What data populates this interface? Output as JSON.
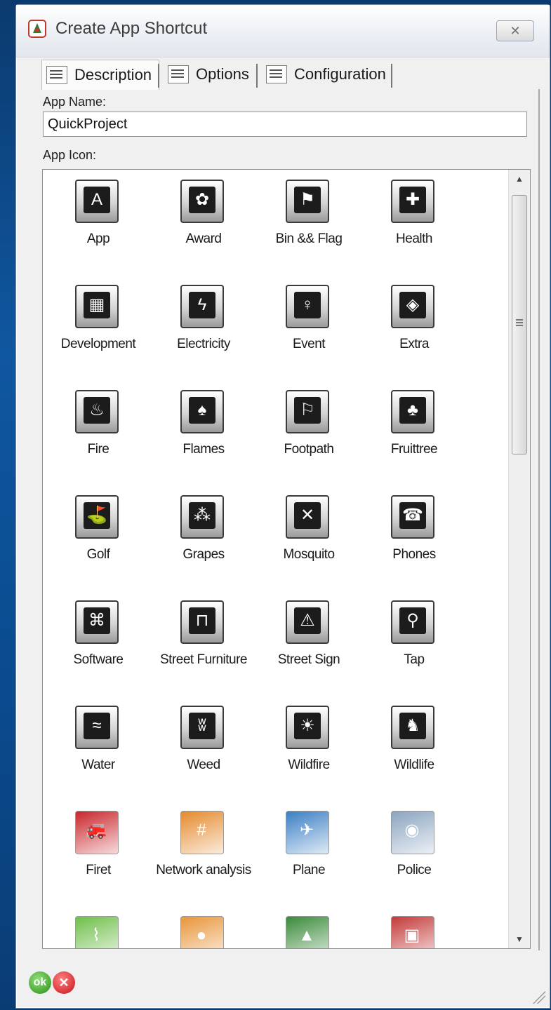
{
  "window": {
    "title": "Create App Shortcut",
    "close_glyph": "✕",
    "accent_color": "#0f57a0"
  },
  "tabs": [
    {
      "label": "Description",
      "icon": "description-tab-icon",
      "active": true
    },
    {
      "label": "Options",
      "icon": "options-tab-icon",
      "active": false
    },
    {
      "label": "Configuration",
      "icon": "configuration-tab-icon",
      "active": false
    }
  ],
  "form": {
    "app_name_label": "App Name:",
    "app_name_value": "QuickProject",
    "app_icon_label": "App Icon:"
  },
  "icons": [
    {
      "label": "App",
      "icon": "app-icon",
      "glyph": "A"
    },
    {
      "label": "Award",
      "icon": "award-icon",
      "glyph": "✿"
    },
    {
      "label": "Bin && Flag",
      "icon": "bin-flag-icon",
      "glyph": "⚑"
    },
    {
      "label": "Health",
      "icon": "health-icon",
      "glyph": "✚"
    },
    {
      "label": "Development",
      "icon": "development-icon",
      "glyph": "▦"
    },
    {
      "label": "Electricity",
      "icon": "electricity-icon",
      "glyph": "ϟ"
    },
    {
      "label": "Event",
      "icon": "event-icon",
      "glyph": "♀"
    },
    {
      "label": "Extra",
      "icon": "extra-icon",
      "glyph": "◈"
    },
    {
      "label": "Fire",
      "icon": "fire-icon",
      "glyph": "♨"
    },
    {
      "label": "Flames",
      "icon": "flames-icon",
      "glyph": "♠"
    },
    {
      "label": "Footpath",
      "icon": "footpath-icon",
      "glyph": "⚐"
    },
    {
      "label": "Fruittree",
      "icon": "fruittree-icon",
      "glyph": "♣"
    },
    {
      "label": "Golf",
      "icon": "golf-icon",
      "glyph": "⛳"
    },
    {
      "label": "Grapes",
      "icon": "grapes-icon",
      "glyph": "⁂"
    },
    {
      "label": "Mosquito",
      "icon": "mosquito-icon",
      "glyph": "✕"
    },
    {
      "label": "Phones",
      "icon": "phones-icon",
      "glyph": "☎"
    },
    {
      "label": "Software",
      "icon": "software-icon",
      "glyph": "⌘"
    },
    {
      "label": "Street Furniture",
      "icon": "street-furniture-icon",
      "glyph": "⊓"
    },
    {
      "label": "Street Sign",
      "icon": "street-sign-icon",
      "glyph": "⚠"
    },
    {
      "label": "Tap",
      "icon": "tap-icon",
      "glyph": "⚲"
    },
    {
      "label": "Water",
      "icon": "water-icon",
      "glyph": "≈"
    },
    {
      "label": "Weed",
      "icon": "weed-icon",
      "glyph": "ʬ"
    },
    {
      "label": "Wildfire",
      "icon": "wildfire-icon",
      "glyph": "☀"
    },
    {
      "label": "Wildlife",
      "icon": "wildlife-icon",
      "glyph": "♞"
    },
    {
      "label": "Firet",
      "icon": "fire-truck-icon",
      "glyph": "🚒",
      "color": "#c8262c"
    },
    {
      "label": "Network analysis",
      "icon": "network-analysis-icon",
      "glyph": "#",
      "color": "#e58a2e"
    },
    {
      "label": "Plane",
      "icon": "plane-icon",
      "glyph": "✈",
      "color": "#3b7fc4"
    },
    {
      "label": "Police",
      "icon": "police-icon",
      "glyph": "◉",
      "color": "#8aa4c0"
    },
    {
      "label": "",
      "icon": "map-icon",
      "glyph": "⌇",
      "color": "#6fbf4a"
    },
    {
      "label": "",
      "icon": "region-map-icon",
      "glyph": "●",
      "color": "#e8953a"
    },
    {
      "label": "",
      "icon": "terrain-icon",
      "glyph": "▲",
      "color": "#3a8a3a"
    },
    {
      "label": "",
      "icon": "truck-icon",
      "glyph": "▣",
      "color": "#c43a3a"
    }
  ],
  "buttons": {
    "ok_label": "ok",
    "cancel_label": "✕"
  }
}
